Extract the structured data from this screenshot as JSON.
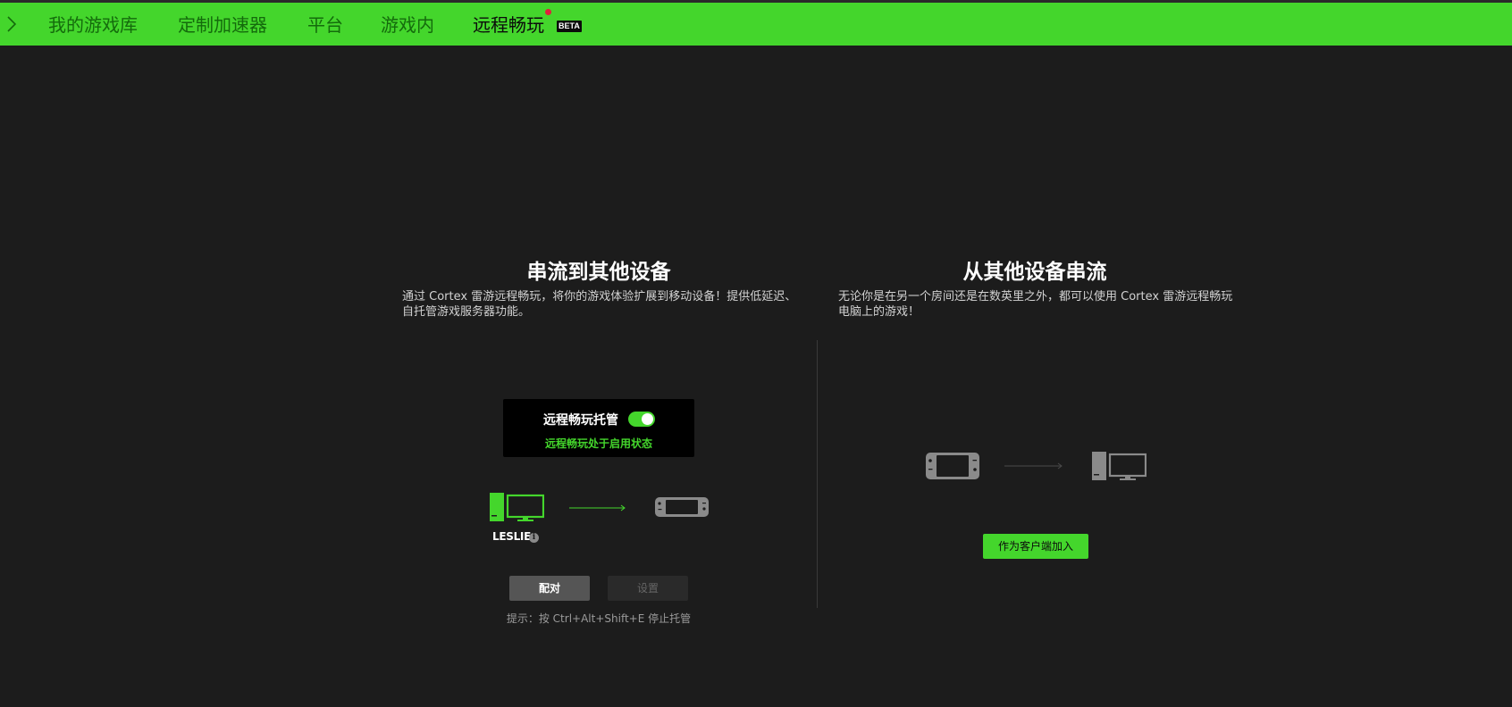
{
  "nav": {
    "items": [
      {
        "label": "我的游戏库"
      },
      {
        "label": "定制加速器"
      },
      {
        "label": "平台"
      },
      {
        "label": "游戏内"
      },
      {
        "label": "远程畅玩"
      }
    ],
    "badge": "BETA",
    "active_index": 4
  },
  "left": {
    "title": "串流到其他设备",
    "description": "通过 Cortex 雷游远程畅玩，将你的游戏体验扩展到移动设备！提供低延迟、自托管游戏服务器功能。",
    "host": {
      "label": "远程畅玩托管",
      "toggle_on": true,
      "status": "远程畅玩处于启用状态"
    },
    "pc_name": "LESLIE",
    "pair_button": "配对",
    "settings_button": "设置",
    "hint": "提示：按 Ctrl+Alt+Shift+E 停止托管"
  },
  "right": {
    "title": "从其他设备串流",
    "description": "无论你是在另一个房间还是在数英里之外，都可以使用 Cortex 雷游远程畅玩电脑上的游戏！",
    "join_button": "作为客户端加入"
  },
  "colors": {
    "accent": "#44d62c",
    "background": "#1c1c1c",
    "inactive_device": "#8a8a8a"
  },
  "icons": {
    "nav_arrow": "chevron-right-icon",
    "pc": "desktop-pc-icon",
    "handheld": "handheld-console-icon",
    "info": "info-icon"
  }
}
